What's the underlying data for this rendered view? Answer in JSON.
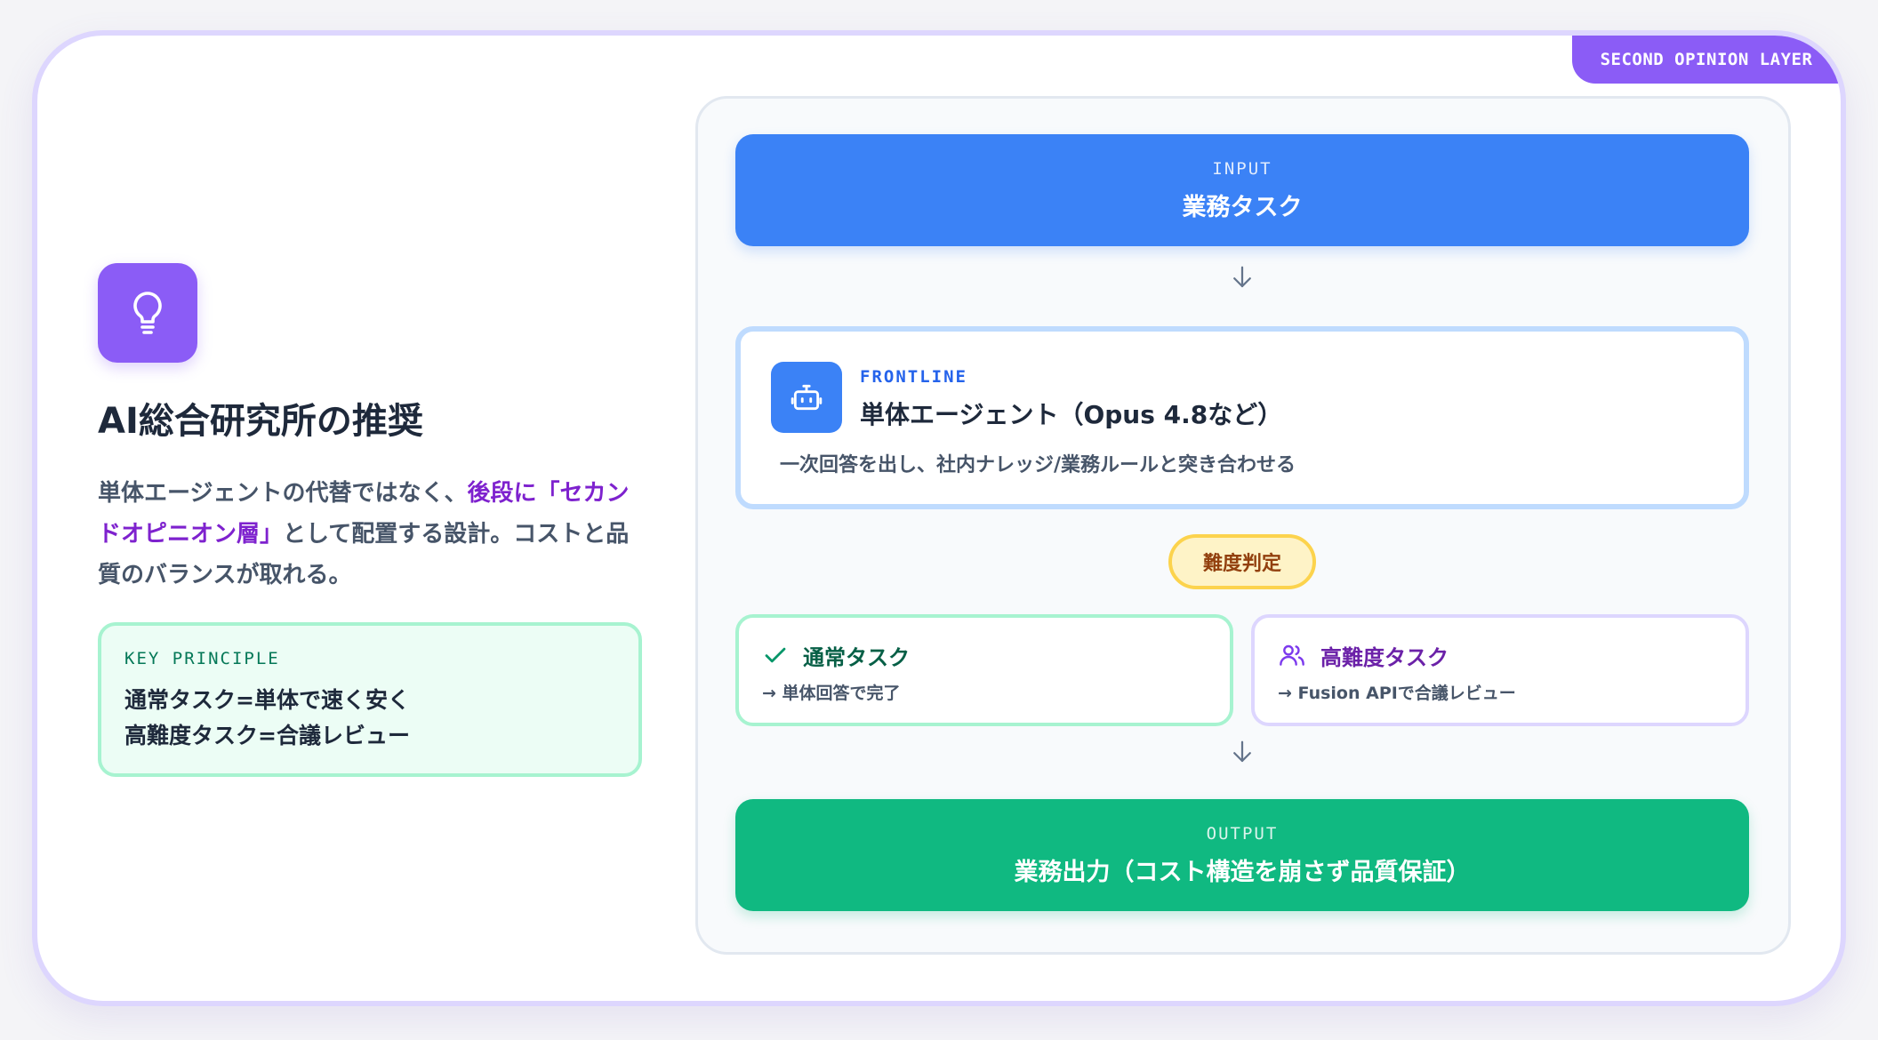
{
  "badge": "SECOND OPINION LAYER",
  "left": {
    "icon": "lightbulb-icon",
    "title": "AI総合研究所の推奨",
    "desc_before": "単体エージェントの代替ではなく、",
    "desc_highlight": "後段に「セカンドオピニオン層」",
    "desc_after": "として配置する設計。コストと品質のバランスが取れる。",
    "principle_label": "KEY PRINCIPLE",
    "principle_line1": "通常タスク=単体で速く安く",
    "principle_line2": "高難度タスク=合議レビュー"
  },
  "flow": {
    "input_caption": "INPUT",
    "input_title": "業務タスク",
    "frontline_caption": "FRONTLINE",
    "frontline_title": "単体エージェント（Opus 4.8など）",
    "frontline_desc": "一次回答を出し、社内ナレッジ/業務ルールと突き合わせる",
    "judge_label": "難度判定",
    "normal_title": "通常タスク",
    "normal_note": "→ 単体回答で完了",
    "hard_title": "高難度タスク",
    "hard_note": "→ Fusion APIで合議レビュー",
    "output_caption": "OUTPUT",
    "output_title": "業務出力（コスト構造を崩さず品質保証）"
  },
  "colors": {
    "accent_purple": "#8b5cf6",
    "input_blue": "#3b82f6",
    "output_green": "#10b981",
    "judge_amber": "#fcd34d"
  }
}
